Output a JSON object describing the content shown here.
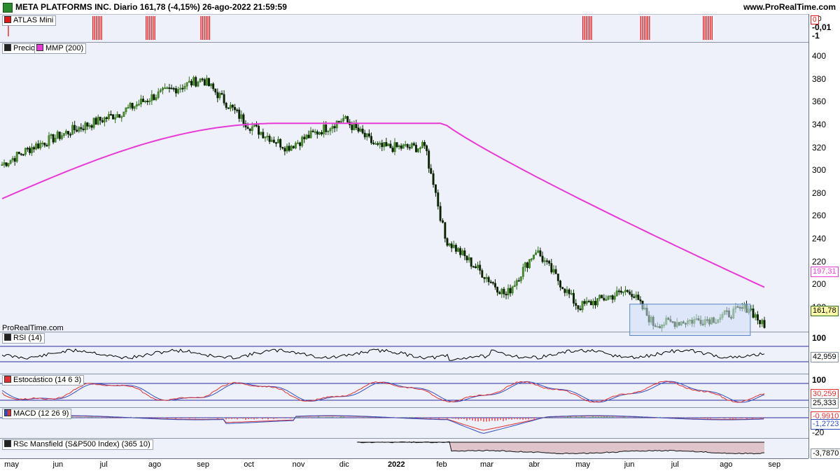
{
  "header": {
    "title": "META PLATFORMS INC. Diario 161,78 (-4,15%) 26-ago-2022 21:59:59",
    "site": "www.ProRealTime.com"
  },
  "watermark": "ProRealTime.com",
  "panels": {
    "atlas": {
      "label": "ATLAS Mini",
      "ticks": [
        "0",
        "-0,01",
        "-1"
      ],
      "value_box": "0"
    },
    "price": {
      "label_price": "Precio",
      "label_ma": "MMP (200)",
      "ticks": [
        "400",
        "380",
        "360",
        "340",
        "320",
        "300",
        "280",
        "260",
        "240",
        "220",
        "200",
        "180"
      ],
      "ma_value": "197,31",
      "last_value": "161,78"
    },
    "rsi": {
      "label": "RSI (14)",
      "ticks": [
        "100"
      ],
      "value": "42,959"
    },
    "stoch": {
      "label": "Estocástico (14 6 3)",
      "ticks": [
        "100"
      ],
      "value1": "30,259",
      "value2": "25,333"
    },
    "macd": {
      "label": "MACD (12 26 9)",
      "ticks": [
        "-20"
      ],
      "value1": "-0,9910",
      "value2": "-1,2723"
    },
    "mansfield": {
      "label": "RSc Mansfield (S&P500 Index) (365 10)",
      "value": "-3,7870"
    }
  },
  "x_axis": [
    "may",
    "jun",
    "jul",
    "ago",
    "sep",
    "oct",
    "nov",
    "dic",
    "2022",
    "feb",
    "mar",
    "abr",
    "may",
    "jun",
    "jul",
    "ago",
    "sep"
  ],
  "colors": {
    "bull": "#2f6e1f",
    "bear": "#0a2200",
    "ma": "#e83ad6",
    "rsi": "#000000",
    "stoch_k": "#e03030",
    "stoch_d": "#3050c0",
    "macd": "#3050c0",
    "signal": "#e03030",
    "atlas": "#e01818",
    "box_fill": "#cfe0f8",
    "box_stroke": "#5a86c8"
  },
  "chart_data": {
    "type": "candlestick",
    "title": "META PLATFORMS INC. Diario",
    "price_ylim": [
      150,
      405
    ],
    "moving_average_200": {
      "start": 275,
      "peak": 341,
      "end": 197.31
    },
    "close_path": [
      {
        "date": "2021-04-26",
        "close": 305
      },
      {
        "date": "2021-05-15",
        "close": 320
      },
      {
        "date": "2021-06-10",
        "close": 335
      },
      {
        "date": "2021-07-10",
        "close": 350
      },
      {
        "date": "2021-08-01",
        "close": 365
      },
      {
        "date": "2021-09-01",
        "close": 380
      },
      {
        "date": "2021-09-30",
        "close": 340
      },
      {
        "date": "2021-10-25",
        "close": 320
      },
      {
        "date": "2021-11-30",
        "close": 345
      },
      {
        "date": "2021-12-22",
        "close": 320
      },
      {
        "date": "2022-01-25",
        "close": 300
      },
      {
        "date": "2022-02-03",
        "close": 240
      },
      {
        "date": "2022-03-14",
        "close": 190
      },
      {
        "date": "2022-04-02",
        "close": 230
      },
      {
        "date": "2022-04-29",
        "close": 180
      },
      {
        "date": "2022-06-01",
        "close": 195
      },
      {
        "date": "2022-06-16",
        "close": 165
      },
      {
        "date": "2022-07-26",
        "close": 170
      },
      {
        "date": "2022-08-16",
        "close": 180
      },
      {
        "date": "2022-08-26",
        "close": 161.78
      }
    ],
    "atlas_signals": [
      "2021-04-30",
      "2021-06-23",
      "2021-07-27",
      "2021-08-31",
      "2022-05-02",
      "2022-06-08",
      "2022-07-18"
    ]
  }
}
